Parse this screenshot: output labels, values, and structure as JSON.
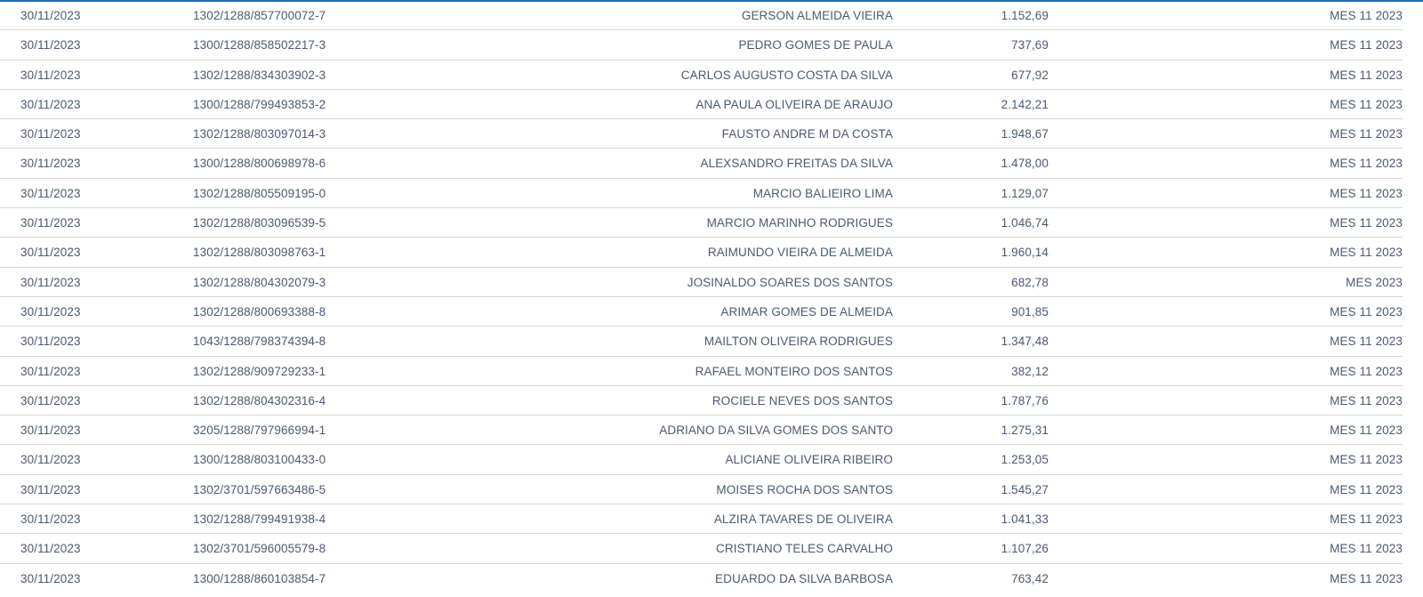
{
  "rows": [
    {
      "date": "30/11/2023",
      "ref": "1302/1288/857700072-7",
      "name": "GERSON ALMEIDA VIEIRA",
      "amount": "1.152,69",
      "period": "MES 11 2023"
    },
    {
      "date": "30/11/2023",
      "ref": "1300/1288/858502217-3",
      "name": "PEDRO GOMES DE PAULA",
      "amount": "737,69",
      "period": "MES 11 2023"
    },
    {
      "date": "30/11/2023",
      "ref": "1302/1288/834303902-3",
      "name": "CARLOS AUGUSTO COSTA DA SILVA",
      "amount": "677,92",
      "period": "MES 11 2023"
    },
    {
      "date": "30/11/2023",
      "ref": "1300/1288/799493853-2",
      "name": "ANA PAULA OLIVEIRA DE ARAUJO",
      "amount": "2.142,21",
      "period": "MES 11 2023"
    },
    {
      "date": "30/11/2023",
      "ref": "1302/1288/803097014-3",
      "name": "FAUSTO ANDRE M DA COSTA",
      "amount": "1.948,67",
      "period": "MES 11 2023"
    },
    {
      "date": "30/11/2023",
      "ref": "1300/1288/800698978-6",
      "name": "ALEXSANDRO FREITAS DA SILVA",
      "amount": "1.478,00",
      "period": "MES 11 2023"
    },
    {
      "date": "30/11/2023",
      "ref": "1302/1288/805509195-0",
      "name": "MARCIO BALIEIRO LIMA",
      "amount": "1.129,07",
      "period": "MES 11 2023"
    },
    {
      "date": "30/11/2023",
      "ref": "1302/1288/803096539-5",
      "name": "MARCIO MARINHO RODRIGUES",
      "amount": "1.046,74",
      "period": "MES 11 2023"
    },
    {
      "date": "30/11/2023",
      "ref": "1302/1288/803098763-1",
      "name": "RAIMUNDO VIEIRA DE ALMEIDA",
      "amount": "1.960,14",
      "period": "MES 11 2023"
    },
    {
      "date": "30/11/2023",
      "ref": "1302/1288/804302079-3",
      "name": "JOSINALDO SOARES DOS SANTOS",
      "amount": "682,78",
      "period": "MES 2023"
    },
    {
      "date": "30/11/2023",
      "ref": "1302/1288/800693388-8",
      "name": "ARIMAR GOMES DE ALMEIDA",
      "amount": "901,85",
      "period": "MES 11 2023"
    },
    {
      "date": "30/11/2023",
      "ref": "1043/1288/798374394-8",
      "name": "MAILTON OLIVEIRA RODRIGUES",
      "amount": "1.347,48",
      "period": "MES 11 2023"
    },
    {
      "date": "30/11/2023",
      "ref": "1302/1288/909729233-1",
      "name": "RAFAEL MONTEIRO DOS SANTOS",
      "amount": "382,12",
      "period": "MES 11 2023"
    },
    {
      "date": "30/11/2023",
      "ref": "1302/1288/804302316-4",
      "name": "ROCIELE NEVES DOS SANTOS",
      "amount": "1.787,76",
      "period": "MES 11 2023"
    },
    {
      "date": "30/11/2023",
      "ref": "3205/1288/797966994-1",
      "name": "ADRIANO DA SILVA GOMES DOS SANTO",
      "amount": "1.275,31",
      "period": "MES 11 2023"
    },
    {
      "date": "30/11/2023",
      "ref": "1300/1288/803100433-0",
      "name": "ALICIANE OLIVEIRA RIBEIRO",
      "amount": "1.253,05",
      "period": "MES 11 2023"
    },
    {
      "date": "30/11/2023",
      "ref": "1302/3701/597663486-5",
      "name": "MOISES ROCHA DOS SANTOS",
      "amount": "1.545,27",
      "period": "MES 11 2023"
    },
    {
      "date": "30/11/2023",
      "ref": "1302/1288/799491938-4",
      "name": "ALZIRA TAVARES DE OLIVEIRA",
      "amount": "1.041,33",
      "period": "MES 11 2023"
    },
    {
      "date": "30/11/2023",
      "ref": "1302/3701/596005579-8",
      "name": "CRISTIANO TELES CARVALHO",
      "amount": "1.107,26",
      "period": "MES 11 2023"
    },
    {
      "date": "30/11/2023",
      "ref": "1300/1288/860103854-7",
      "name": "EDUARDO DA SILVA BARBOSA",
      "amount": "763,42",
      "period": "MES 11 2023"
    }
  ]
}
